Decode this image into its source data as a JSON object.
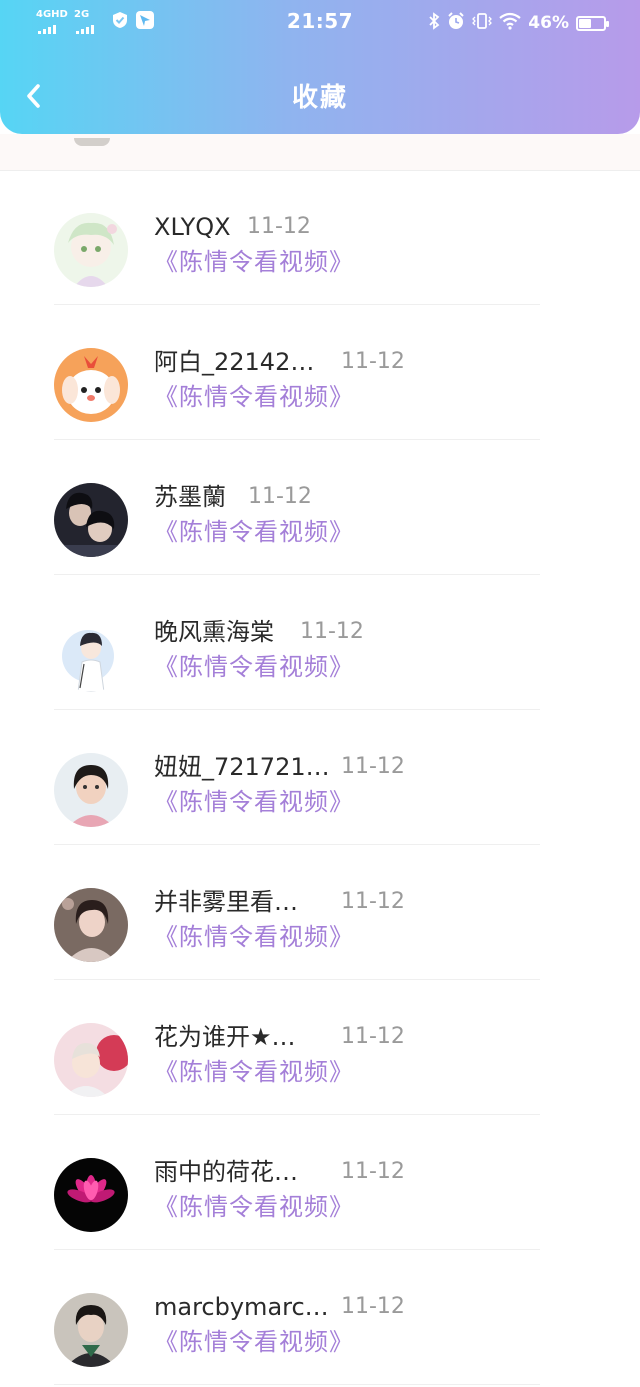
{
  "status_bar": {
    "net1_label": "4GHD",
    "net2_label": "2G",
    "time": "21:57",
    "battery_percent": "46%",
    "battery_level": 0.46
  },
  "header": {
    "title": "收藏",
    "back_icon": "chevron-left-icon"
  },
  "items": [
    {
      "name": "XLYQX",
      "date": "11-12",
      "link": "《陈情令看视频》"
    },
    {
      "name": "阿白_22142…",
      "date": "11-12",
      "link": "《陈情令看视频》"
    },
    {
      "name": "苏墨蘭",
      "date": "11-12",
      "link": "《陈情令看视频》"
    },
    {
      "name": "晚风熏海棠",
      "date": "11-12",
      "link": "《陈情令看视频》"
    },
    {
      "name": "妞妞_721721…",
      "date": "11-12",
      "link": "《陈情令看视频》"
    },
    {
      "name": "并非雾里看…",
      "date": "11-12",
      "link": "《陈情令看视频》"
    },
    {
      "name": "花为谁开★…",
      "date": "11-12",
      "link": "《陈情令看视频》"
    },
    {
      "name": "雨中的荷花…",
      "date": "11-12",
      "link": "《陈情令看视频》"
    },
    {
      "name": "marcbymarc…",
      "date": "11-12",
      "link": "《陈情令看视频》"
    }
  ]
}
